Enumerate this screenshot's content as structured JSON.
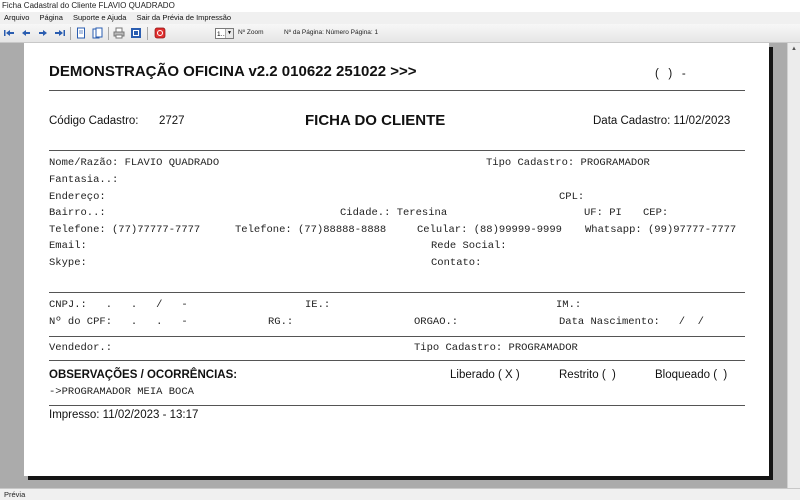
{
  "window": {
    "title": "Ficha Cadastral do Cliente FLAVIO QUADRADO"
  },
  "menu": {
    "items": [
      "Arquivo",
      "Página",
      "Suporte e Ajuda",
      "Sair da Prévia de Impressão"
    ]
  },
  "toolbar": {
    "page_select": "1...",
    "zoom_label": "Nº Zoom",
    "page_info": "Nº da Página: Número Página: 1"
  },
  "status": {
    "text": "Prévia"
  },
  "report": {
    "title": "DEMONSTRAÇÃO OFICINA v2.2 010622 251022 >>>",
    "phone_mask": "(   )   -",
    "codigo_label": "Código Cadastro:",
    "codigo_value": "2727",
    "heading": "FICHA DO CLIENTE",
    "data_cadastro": "Data Cadastro: 11/02/2023",
    "nome": "Nome/Razão: FLAVIO QUADRADO",
    "tipo_cadastro_1": "Tipo Cadastro: PROGRAMADOR",
    "fantasia": "Fantasia..:",
    "endereco": "Endereço:",
    "cpl": "CPL:",
    "bairro": "Bairro..:",
    "cidade": "Cidade.: Teresina",
    "uf": "UF: PI",
    "cep": "CEP:",
    "telefone1": "Telefone: (77)77777-7777",
    "telefone2": "Telefone: (77)88888-8888",
    "celular": "Celular: (88)99999-9999",
    "whatsapp": "Whatsapp: (99)97777-7777",
    "email": "Email:",
    "rede_social": "Rede Social:",
    "skype": "Skype:",
    "contato": "Contato:",
    "cnpj": "CNPJ.:   .   .   /   -",
    "ie": "IE.:",
    "im": "IM.:",
    "cpf": "Nº do CPF:   .   .   -",
    "rg": "RG.:",
    "orgao": "ORGAO.:",
    "nascimento": "Data Nascimento:   /  /",
    "vendedor": "Vendedor.:",
    "tipo_cadastro_2": "Tipo Cadastro: PROGRAMADOR",
    "observacoes_label": "OBSERVAÇÕES / OCORRÊNCIAS:",
    "liberado": "Liberado ( X )",
    "restrito": "Restrito (  )",
    "bloqueado": "Bloqueado (  )",
    "observacao_text": "->PROGRAMADOR MEIA BOCA",
    "impresso": "Impresso: 11/02/2023 - 13:17"
  }
}
